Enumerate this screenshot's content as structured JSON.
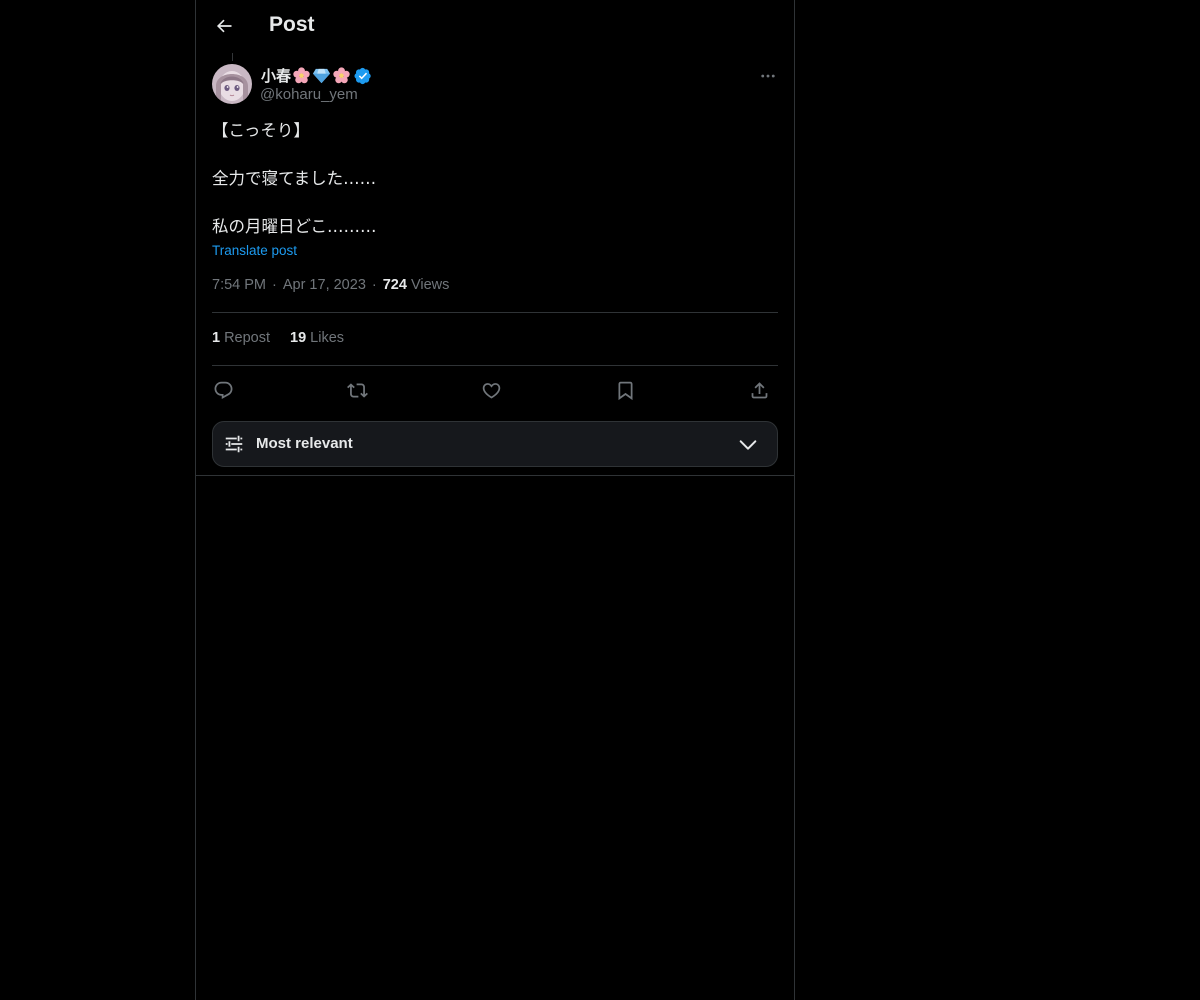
{
  "header": {
    "title": "Post",
    "back_icon": "arrow-left-icon"
  },
  "post": {
    "author": {
      "display_name": "小春",
      "name_emojis": [
        "cherry-blossom",
        "gem",
        "cherry-blossom"
      ],
      "verified": true,
      "handle": "@koharu_yem",
      "avatar_icon": "avatar-image"
    },
    "more_icon": "more-horizontal-icon",
    "text_lines": [
      "【こっそり】",
      "",
      "全力で寝てました……",
      "",
      "私の月曜日どこ………"
    ],
    "translate_label": "Translate post",
    "meta": {
      "time": "7:54 PM",
      "date": "Apr 17, 2023",
      "views_count": "724",
      "views_label": "Views",
      "separator": "·"
    },
    "stats": {
      "reposts_count": "1",
      "reposts_label": "Repost",
      "likes_count": "19",
      "likes_label": "Likes"
    },
    "actions": [
      "reply-icon",
      "repost-icon",
      "like-icon",
      "bookmark-icon",
      "share-icon"
    ]
  },
  "replies_sort": {
    "label": "Most relevant",
    "icon": "sliders-icon",
    "chevron": "chevron-down-icon"
  },
  "colors": {
    "background": "#000000",
    "text": "#e7e9ea",
    "secondary_text": "#71767b",
    "link": "#1d9bf0",
    "border": "#2f3336",
    "verified": "#1d9bf0",
    "sort_box": "#16181c"
  }
}
